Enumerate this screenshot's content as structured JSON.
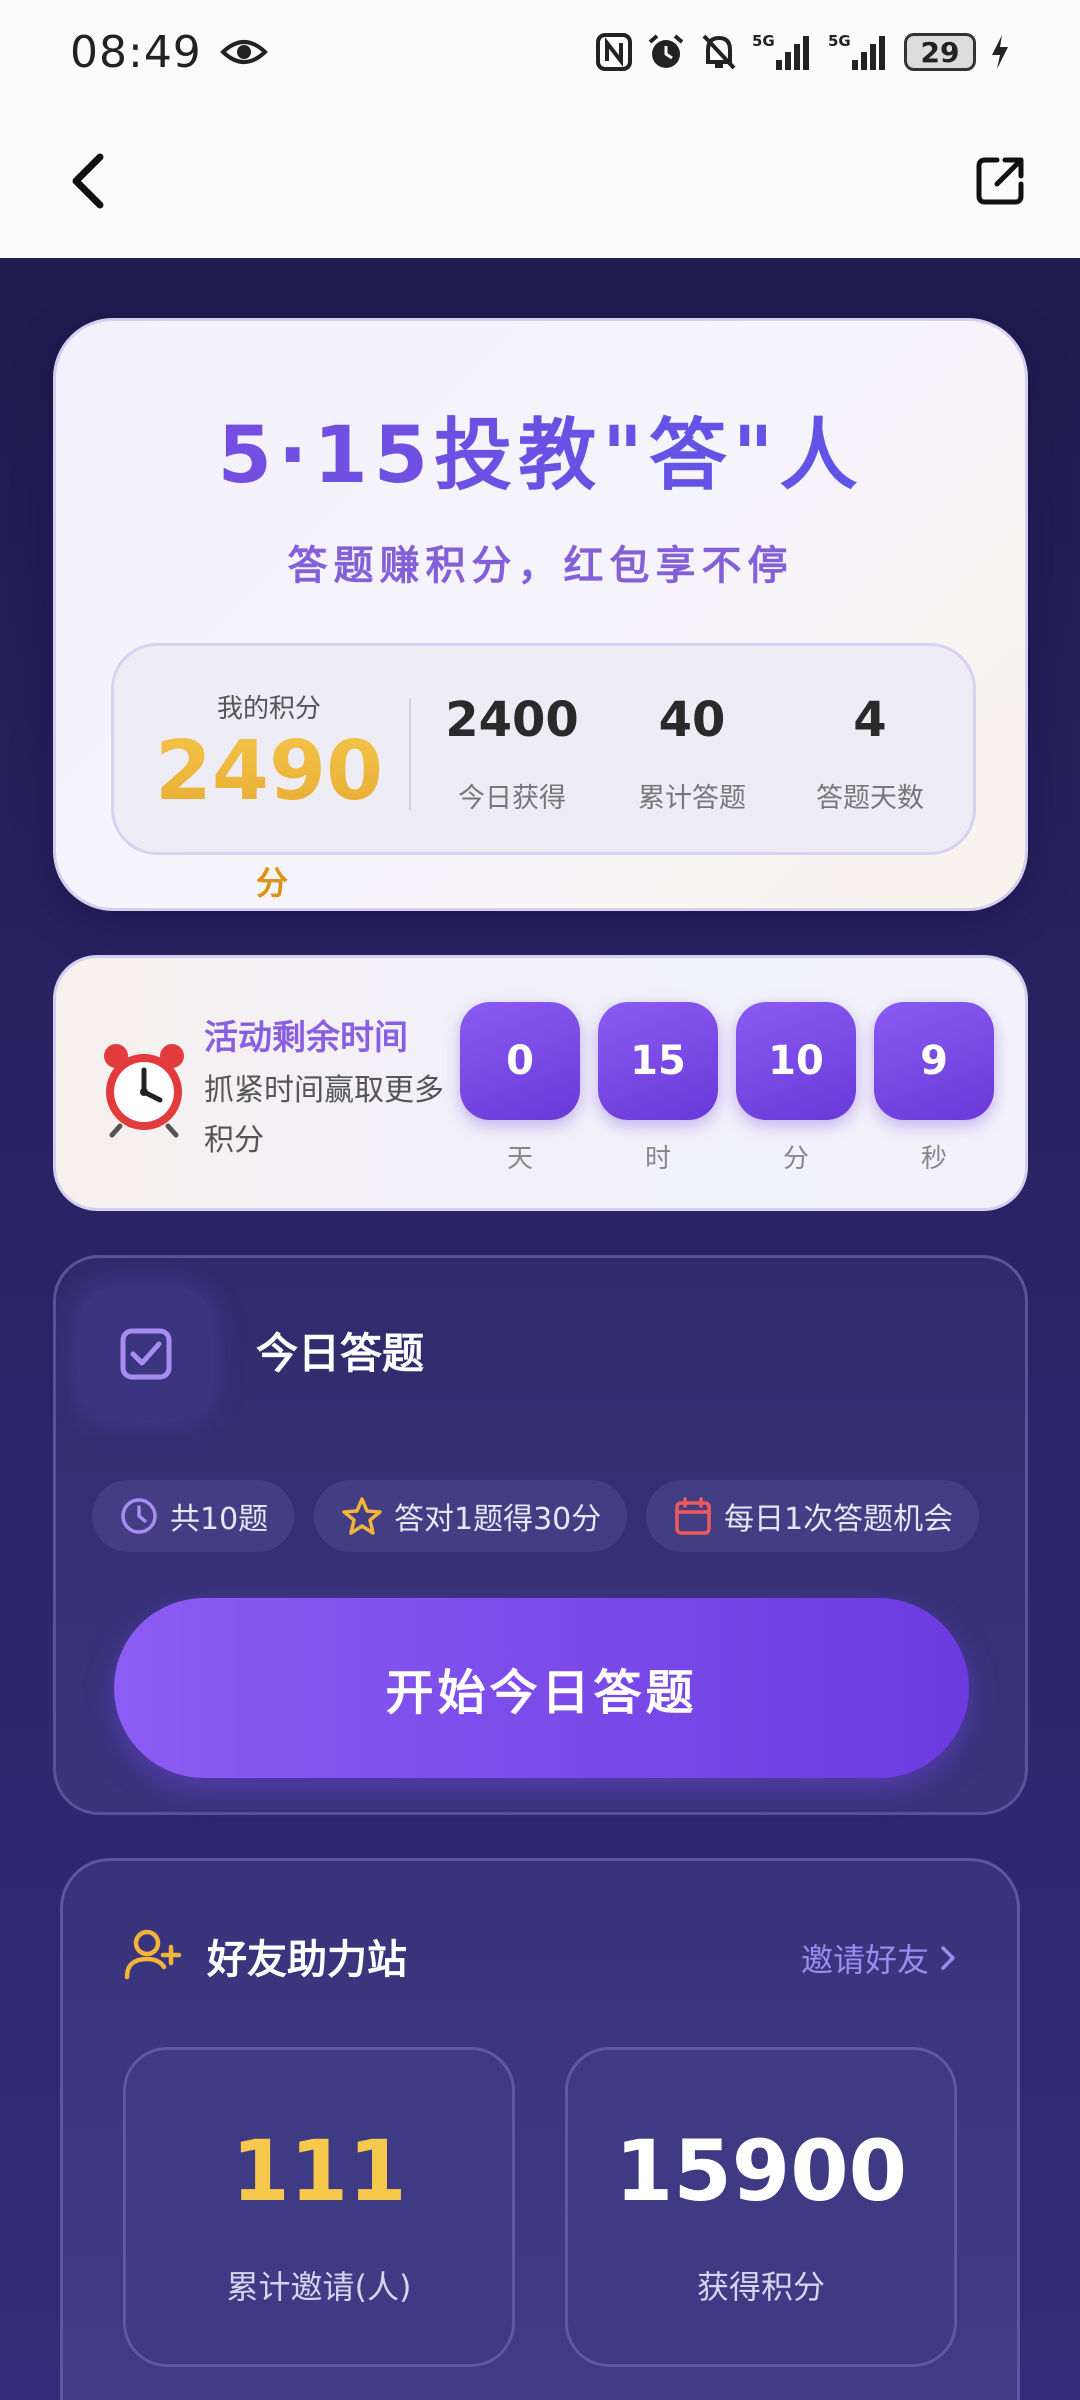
{
  "status_bar": {
    "time": "08:49",
    "battery": "29",
    "icons": [
      "eye-icon",
      "nfc-icon",
      "alarm-icon",
      "mute-icon",
      "signal-5g-icon",
      "signal-5g-icon",
      "battery-icon",
      "charging-icon"
    ]
  },
  "nav": {
    "back_icon": "back-arrow-icon",
    "share_icon": "share-icon"
  },
  "hero": {
    "title": "5·15投教\"答\"人",
    "subtitle": "答题赚积分，红包享不停",
    "my_points_label": "我的积分",
    "my_points_value": "2490",
    "my_points_unit": "分",
    "stats": [
      {
        "value": "2400",
        "label": "今日获得"
      },
      {
        "value": "40",
        "label": "累计答题"
      },
      {
        "value": "4",
        "label": "答题天数"
      }
    ]
  },
  "countdown": {
    "icon": "alarm-clock-icon",
    "title": "活动剩余时间",
    "subtitle": "抓紧时间赢取更多积分",
    "items": [
      {
        "value": "0",
        "unit": "天"
      },
      {
        "value": "15",
        "unit": "时"
      },
      {
        "value": "10",
        "unit": "分"
      },
      {
        "value": "9",
        "unit": "秒"
      }
    ]
  },
  "quiz": {
    "icon": "checkbox-icon",
    "title": "今日答题",
    "tags": [
      {
        "icon": "clock-icon",
        "label": "共10题"
      },
      {
        "icon": "star-icon",
        "label": "答对1题得30分"
      },
      {
        "icon": "calendar-icon",
        "label": "每日1次答题机会"
      }
    ],
    "start_label": "开始今日答题"
  },
  "friends": {
    "icon": "add-user-icon",
    "title": "好友助力站",
    "invite_label": "邀请好友",
    "stats": [
      {
        "value": "111",
        "label": "累计邀请(人)",
        "color": "#f6c94c"
      },
      {
        "value": "15900",
        "label": "获得积分",
        "color": "#ffffff"
      }
    ]
  },
  "colors": {
    "accent_purple": "#7a4de0",
    "gold": "#e8a72c",
    "background_dark": "#1f1b4d"
  }
}
